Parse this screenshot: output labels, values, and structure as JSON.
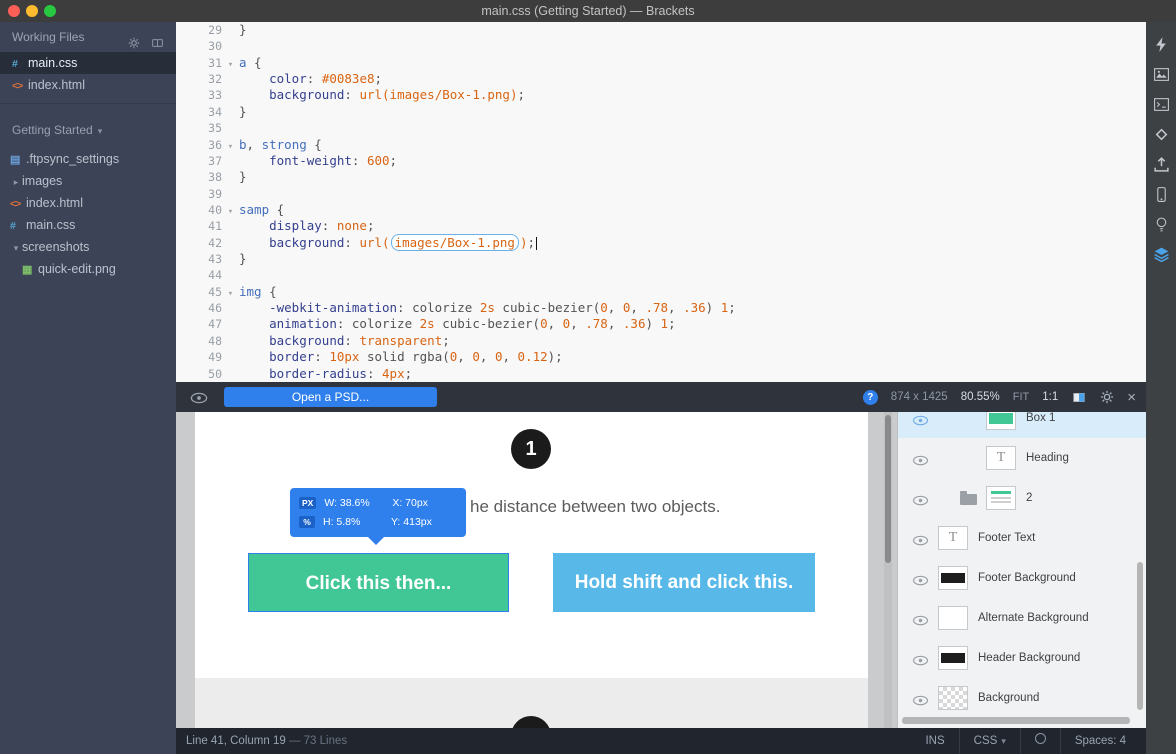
{
  "titlebar": {
    "title": "main.css (Getting Started) — Brackets"
  },
  "sidebar": {
    "working_files_label": "Working Files",
    "working_files": [
      {
        "name": "main.css",
        "type": "css",
        "active": true
      },
      {
        "name": "index.html",
        "type": "html",
        "active": false
      }
    ],
    "project": {
      "name": "Getting Started",
      "caret": "▾"
    },
    "tree": [
      {
        "name": ".ftpsync_settings",
        "kind": "file",
        "indent": 0
      },
      {
        "name": "images",
        "kind": "folder",
        "state": "collapsed",
        "indent": 0
      },
      {
        "name": "index.html",
        "kind": "html",
        "indent": 0
      },
      {
        "name": "main.css",
        "kind": "css",
        "indent": 0
      },
      {
        "name": "screenshots",
        "kind": "folder",
        "state": "expanded",
        "indent": 0
      },
      {
        "name": "quick-edit.png",
        "kind": "image",
        "indent": 1
      }
    ]
  },
  "editor": {
    "lines": [
      {
        "n": "29",
        "tokens": [
          [
            "pl",
            "}"
          ]
        ]
      },
      {
        "n": "30",
        "tokens": []
      },
      {
        "n": "31",
        "fold": true,
        "tokens": [
          [
            "sel",
            "a"
          ],
          [
            "pl",
            " {"
          ]
        ]
      },
      {
        "n": "32",
        "tokens": [
          [
            "pl",
            "    "
          ],
          [
            "prop",
            "color"
          ],
          [
            "pl",
            ": "
          ],
          [
            "val",
            "#0083e8"
          ],
          [
            "pl",
            ";"
          ]
        ]
      },
      {
        "n": "33",
        "tokens": [
          [
            "pl",
            "    "
          ],
          [
            "prop",
            "background"
          ],
          [
            "pl",
            ": "
          ],
          [
            "val",
            "url(images/Box-1.png)"
          ],
          [
            "pl",
            ";"
          ]
        ]
      },
      {
        "n": "34",
        "tokens": [
          [
            "pl",
            "}"
          ]
        ]
      },
      {
        "n": "35",
        "tokens": []
      },
      {
        "n": "36",
        "fold": true,
        "tokens": [
          [
            "sel",
            "b"
          ],
          [
            "pl",
            ", "
          ],
          [
            "sel",
            "strong"
          ],
          [
            "pl",
            " {"
          ]
        ]
      },
      {
        "n": "37",
        "tokens": [
          [
            "pl",
            "    "
          ],
          [
            "prop",
            "font-weight"
          ],
          [
            "pl",
            ": "
          ],
          [
            "val",
            "600"
          ],
          [
            "pl",
            ";"
          ]
        ]
      },
      {
        "n": "38",
        "tokens": [
          [
            "pl",
            "}"
          ]
        ]
      },
      {
        "n": "39",
        "tokens": []
      },
      {
        "n": "40",
        "fold": true,
        "tokens": [
          [
            "sel",
            "samp"
          ],
          [
            "pl",
            " {"
          ]
        ]
      },
      {
        "n": "41",
        "tokens": [
          [
            "pl",
            "    "
          ],
          [
            "prop",
            "display"
          ],
          [
            "pl",
            ": "
          ],
          [
            "val",
            "none"
          ],
          [
            "pl",
            ";"
          ]
        ]
      },
      {
        "n": "42",
        "tokens": [
          [
            "pl",
            "    "
          ],
          [
            "prop",
            "background"
          ],
          [
            "pl",
            ": "
          ],
          [
            "val",
            "url("
          ],
          [
            "box",
            "images/Box-1.png"
          ],
          [
            "val",
            ")"
          ],
          [
            "pl",
            ";"
          ],
          [
            "cur",
            ""
          ]
        ]
      },
      {
        "n": "43",
        "tokens": [
          [
            "pl",
            "}"
          ]
        ]
      },
      {
        "n": "44",
        "tokens": []
      },
      {
        "n": "45",
        "fold": true,
        "tokens": [
          [
            "sel",
            "img"
          ],
          [
            "pl",
            " {"
          ]
        ]
      },
      {
        "n": "46",
        "tokens": [
          [
            "pl",
            "    "
          ],
          [
            "prop",
            "-webkit-animation"
          ],
          [
            "pl",
            ": colorize "
          ],
          [
            "val",
            "2s"
          ],
          [
            "pl",
            " cubic-bezier("
          ],
          [
            "val",
            "0"
          ],
          [
            "pl",
            ", "
          ],
          [
            "val",
            "0"
          ],
          [
            "pl",
            ", "
          ],
          [
            "val",
            ".78"
          ],
          [
            "pl",
            ", "
          ],
          [
            "val",
            ".36"
          ],
          [
            "pl",
            ") "
          ],
          [
            "val",
            "1"
          ],
          [
            "pl",
            ";"
          ]
        ]
      },
      {
        "n": "47",
        "tokens": [
          [
            "pl",
            "    "
          ],
          [
            "prop",
            "animation"
          ],
          [
            "pl",
            ": colorize "
          ],
          [
            "val",
            "2s"
          ],
          [
            "pl",
            " cubic-bezier("
          ],
          [
            "val",
            "0"
          ],
          [
            "pl",
            ", "
          ],
          [
            "val",
            "0"
          ],
          [
            "pl",
            ", "
          ],
          [
            "val",
            ".78"
          ],
          [
            "pl",
            ", "
          ],
          [
            "val",
            ".36"
          ],
          [
            "pl",
            ") "
          ],
          [
            "val",
            "1"
          ],
          [
            "pl",
            ";"
          ]
        ]
      },
      {
        "n": "48",
        "tokens": [
          [
            "pl",
            "    "
          ],
          [
            "prop",
            "background"
          ],
          [
            "pl",
            ": "
          ],
          [
            "val",
            "transparent"
          ],
          [
            "pl",
            ";"
          ]
        ]
      },
      {
        "n": "49",
        "tokens": [
          [
            "pl",
            "    "
          ],
          [
            "prop",
            "border"
          ],
          [
            "pl",
            ": "
          ],
          [
            "val",
            "10px"
          ],
          [
            "pl",
            " solid rgba("
          ],
          [
            "val",
            "0"
          ],
          [
            "pl",
            ", "
          ],
          [
            "val",
            "0"
          ],
          [
            "pl",
            ", "
          ],
          [
            "val",
            "0"
          ],
          [
            "pl",
            ", "
          ],
          [
            "val",
            "0.12"
          ],
          [
            "pl",
            ");"
          ]
        ]
      },
      {
        "n": "50",
        "tokens": [
          [
            "pl",
            "    "
          ],
          [
            "prop",
            "border-radius"
          ],
          [
            "pl",
            ": "
          ],
          [
            "val",
            "4px"
          ],
          [
            "pl",
            ";"
          ]
        ]
      }
    ]
  },
  "extract": {
    "open_psd": "Open a PSD...",
    "help": "?",
    "dimensions": "874 x 1425",
    "zoom": "80.55%",
    "fit": "FIT",
    "one_to_one": "1:1",
    "close": "×"
  },
  "preview": {
    "step_number": "1",
    "caption_visible": "he distance between two objects.",
    "tooltip": {
      "row1": {
        "badge": "PX",
        "w": "W: 38.6%",
        "x": "X: 70px"
      },
      "row2": {
        "badge": "%",
        "h": "H: 5.8%",
        "y": "Y: 413px"
      }
    },
    "green_button": "Click this then...",
    "blue_button": "Hold shift and click this."
  },
  "layers": [
    {
      "label": "Box 1",
      "thumb": "green",
      "selected": true,
      "indent": 1
    },
    {
      "label": "Heading",
      "thumb": "text",
      "thumb_glyph": "T",
      "indent": 1
    },
    {
      "label": "2",
      "thumb": "layout",
      "group": true
    },
    {
      "label": "Footer Text",
      "thumb": "text",
      "thumb_glyph": "T"
    },
    {
      "label": "Footer Background",
      "thumb": "dark"
    },
    {
      "label": "Alternate Background",
      "thumb": "light"
    },
    {
      "label": "Header Background",
      "thumb": "dark"
    },
    {
      "label": "Background",
      "thumb": "checker"
    }
  ],
  "statusbar": {
    "cursor_position": "Line 41, Column 19",
    "lines_count": "— 73 Lines",
    "ins": "INS",
    "language": "CSS",
    "language_caret": "▾",
    "spaces": "Spaces: 4"
  },
  "toolbar": {
    "icons": [
      "live-preview-icon",
      "image-viewer-icon",
      "console-icon",
      "diamond-icon",
      "upload-icon",
      "mobile-device-icon",
      "lightbulb-icon",
      "extract-layers-icon"
    ]
  },
  "colors": {
    "accent_blue": "#2f80ed",
    "green_button": "#41c796",
    "blue_button": "#58b9e8",
    "selection_row": "#d8ecfa"
  }
}
